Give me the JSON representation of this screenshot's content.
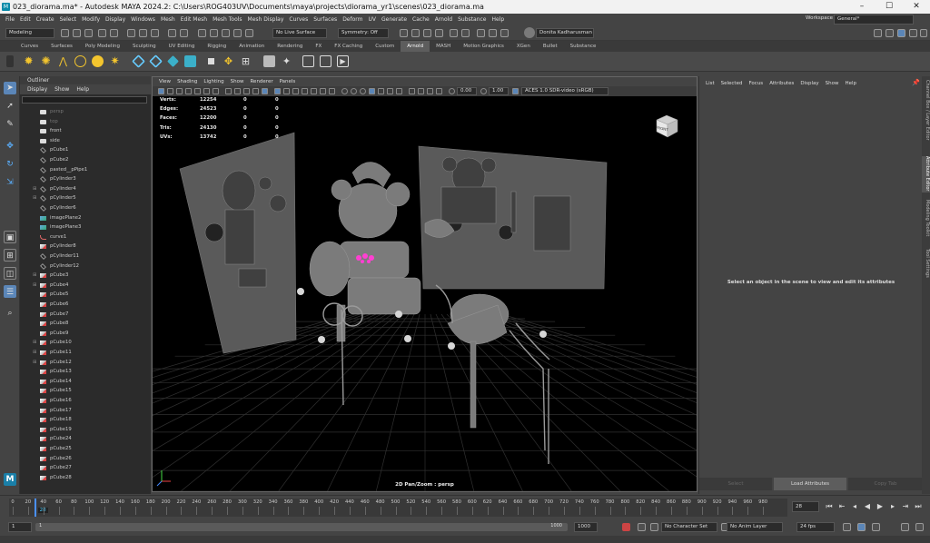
{
  "window": {
    "title": "023_diorama.ma* - Autodesk MAYA 2024.2: C:\\Users\\ROG403UV\\Documents\\maya\\projects\\diorama_yr1\\scenes\\023_diorama.ma",
    "app_icon": "M"
  },
  "menubar": {
    "items": [
      "File",
      "Edit",
      "Create",
      "Select",
      "Modify",
      "Display",
      "Windows",
      "Mesh",
      "Edit Mesh",
      "Mesh Tools",
      "Mesh Display",
      "Curves",
      "Surfaces",
      "Deform",
      "UV",
      "Generate",
      "Cache",
      "Arnold",
      "Substance",
      "Help"
    ],
    "workspace_label": "Workspace :",
    "workspace_value": "General*"
  },
  "statusline": {
    "mode": "Modeling",
    "live_surface": "No Live Surface",
    "symmetry": "Symmetry: Off",
    "user": "Donita Kadharusman"
  },
  "shelf": {
    "tabs": [
      "Curves",
      "Surfaces",
      "Poly Modeling",
      "Sculpting",
      "UV Editing",
      "Rigging",
      "Animation",
      "Rendering",
      "FX",
      "FX Caching",
      "Custom",
      "Arnold",
      "MASH",
      "Motion Graphics",
      "XGen",
      "Bullet",
      "Substance"
    ],
    "active_tab": "Arnold"
  },
  "outliner": {
    "title": "Outliner",
    "menu": [
      "Display",
      "Show",
      "Help"
    ],
    "items": [
      {
        "label": "persp",
        "icon": "camera",
        "dim": true
      },
      {
        "label": "top",
        "icon": "camera",
        "dim": true
      },
      {
        "label": "front",
        "icon": "camera"
      },
      {
        "label": "side",
        "icon": "camera"
      },
      {
        "label": "pCube1",
        "icon": "mesh"
      },
      {
        "label": "pCube2",
        "icon": "mesh"
      },
      {
        "label": "pasted__pPipe1",
        "icon": "mesh"
      },
      {
        "label": "pCylinder3",
        "icon": "mesh"
      },
      {
        "label": "pCylinder4",
        "icon": "mesh",
        "expand": true
      },
      {
        "label": "pCylinder5",
        "icon": "mesh",
        "expand": true
      },
      {
        "label": "pCylinder6",
        "icon": "mesh"
      },
      {
        "label": "imagePlane2",
        "icon": "image"
      },
      {
        "label": "imagePlane3",
        "icon": "image"
      },
      {
        "label": "curve1",
        "icon": "curve"
      },
      {
        "label": "pCylinder8",
        "icon": "cube"
      },
      {
        "label": "pCylinder11",
        "icon": "mesh"
      },
      {
        "label": "pCylinder12",
        "icon": "mesh"
      },
      {
        "label": "pCube3",
        "icon": "cube",
        "expand": true
      },
      {
        "label": "pCube4",
        "icon": "cube",
        "expand": true
      },
      {
        "label": "pCube5",
        "icon": "cube"
      },
      {
        "label": "pCube6",
        "icon": "cube"
      },
      {
        "label": "pCube7",
        "icon": "cube"
      },
      {
        "label": "pCube8",
        "icon": "cube"
      },
      {
        "label": "pCube9",
        "icon": "cube"
      },
      {
        "label": "pCube10",
        "icon": "cube",
        "expand": true
      },
      {
        "label": "pCube11",
        "icon": "cube",
        "expand": true
      },
      {
        "label": "pCube12",
        "icon": "cube",
        "expand": true
      },
      {
        "label": "pCube13",
        "icon": "cube"
      },
      {
        "label": "pCube14",
        "icon": "cube"
      },
      {
        "label": "pCube15",
        "icon": "cube"
      },
      {
        "label": "pCube16",
        "icon": "cube"
      },
      {
        "label": "pCube17",
        "icon": "cube"
      },
      {
        "label": "pCube18",
        "icon": "cube"
      },
      {
        "label": "pCube19",
        "icon": "cube"
      },
      {
        "label": "pCube24",
        "icon": "cube"
      },
      {
        "label": "pCube25",
        "icon": "cube"
      },
      {
        "label": "pCube26",
        "icon": "cube"
      },
      {
        "label": "pCube27",
        "icon": "cube"
      },
      {
        "label": "pCube28",
        "icon": "cube"
      }
    ]
  },
  "viewport": {
    "menu": [
      "View",
      "Shading",
      "Lighting",
      "Show",
      "Renderer",
      "Panels"
    ],
    "exposure": "0.00",
    "gamma": "1.00",
    "color_space": "ACES 1.0 SDR-video (sRGB)",
    "camera_label": "2D Pan/Zoom : persp",
    "viewcube_label": "FRONT",
    "hud": [
      {
        "label": "Verts:",
        "a": "12254",
        "b": "0",
        "c": "0"
      },
      {
        "label": "Edges:",
        "a": "24523",
        "b": "0",
        "c": "0"
      },
      {
        "label": "Faces:",
        "a": "12200",
        "b": "0",
        "c": "0"
      },
      {
        "label": "Tris:",
        "a": "24130",
        "b": "0",
        "c": "0"
      },
      {
        "label": "UVs:",
        "a": "13742",
        "b": "0",
        "c": "0"
      }
    ]
  },
  "attribute_editor": {
    "menu": [
      "List",
      "Selected",
      "Focus",
      "Attributes",
      "Display",
      "Show",
      "Help"
    ],
    "message": "Select an object in the scene to view and edit its attributes",
    "buttons": [
      "Select",
      "Load Attributes",
      "Copy Tab"
    ]
  },
  "side_tabs": [
    "Channel Box / Layer Editor",
    "Attribute Editor",
    "Modeling Toolkit",
    "Tool Settings"
  ],
  "timeline": {
    "ticks": [
      "0",
      "20",
      "40",
      "60",
      "80",
      "100",
      "120",
      "140",
      "160",
      "180",
      "200",
      "220",
      "240",
      "260",
      "280",
      "300",
      "320",
      "340",
      "360",
      "380",
      "400",
      "420",
      "440",
      "460",
      "480",
      "500",
      "520",
      "540",
      "560",
      "580",
      "600",
      "620",
      "640",
      "660",
      "680",
      "700",
      "720",
      "740",
      "760",
      "780",
      "800",
      "820",
      "840",
      "860",
      "880",
      "900",
      "920",
      "940",
      "960",
      "980"
    ],
    "current_frame": "28",
    "frame_field": "28",
    "playhead_fraction": 0.028
  },
  "range": {
    "start": "1",
    "start_inner": "1",
    "end_inner": "1000",
    "end": "1000",
    "character_set": "No Character Set",
    "anim_layer": "No Anim Layer",
    "fps": "24 fps"
  }
}
